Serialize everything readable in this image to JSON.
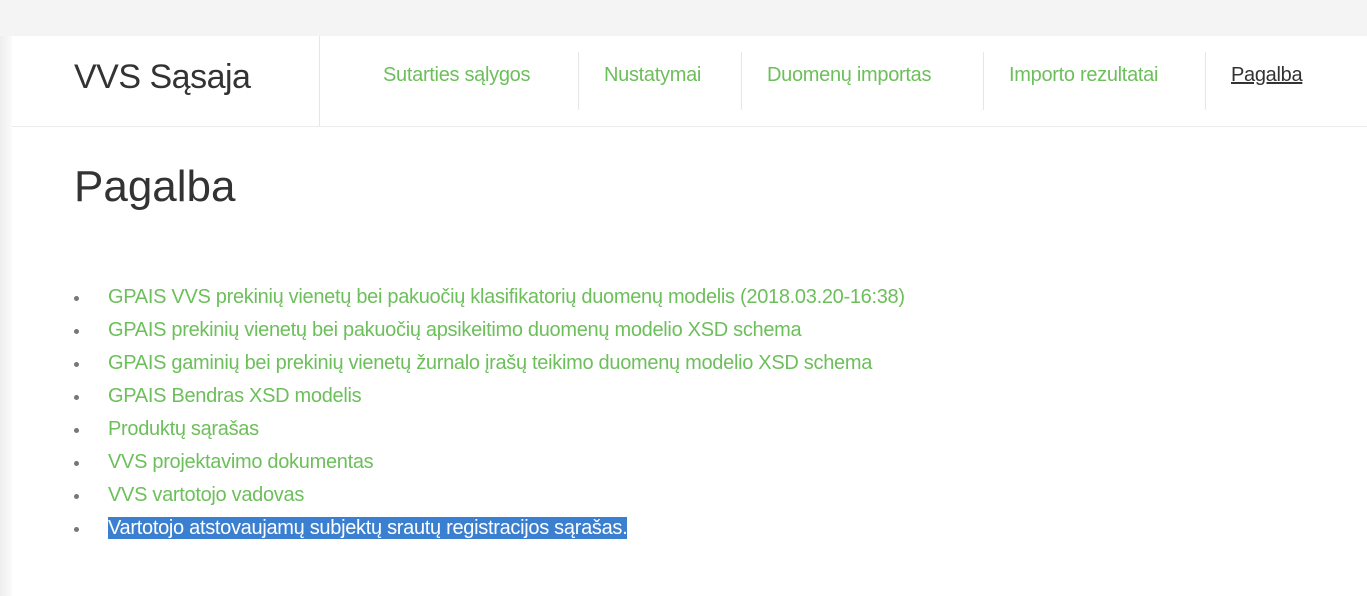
{
  "app": {
    "brand": "VVS Sąsaja"
  },
  "nav": {
    "items": [
      {
        "label": "Sutarties sąlygos",
        "active": false
      },
      {
        "label": "Nustatymai",
        "active": false
      },
      {
        "label": "Duomenų importas",
        "active": false
      },
      {
        "label": "Importo rezultatai",
        "active": false
      },
      {
        "label": "Pagalba",
        "active": true
      }
    ]
  },
  "page": {
    "title": "Pagalba"
  },
  "help_links": [
    {
      "label": "GPAIS VVS prekinių vienetų bei pakuočių klasifikatorių duomenų modelis (2018.03.20-16:38)",
      "selected": false
    },
    {
      "label": "GPAIS prekinių vienetų bei pakuočių apsikeitimo duomenų modelio XSD schema",
      "selected": false
    },
    {
      "label": "GPAIS gaminių bei prekinių vienetų žurnalo įrašų teikimo duomenų modelio XSD schema",
      "selected": false
    },
    {
      "label": "GPAIS Bendras XSD modelis",
      "selected": false
    },
    {
      "label": "Produktų sąrašas",
      "selected": false
    },
    {
      "label": "VVS projektavimo dokumentas",
      "selected": false
    },
    {
      "label": "VVS vartotojo vadovas",
      "selected": false
    },
    {
      "label": "Vartotojo atstovaujamų subjektų srautų registracijos sąrašas.",
      "selected": true
    }
  ],
  "colors": {
    "link": "#6cbf5a",
    "text": "#333333",
    "selection": "#3b7fd0"
  }
}
